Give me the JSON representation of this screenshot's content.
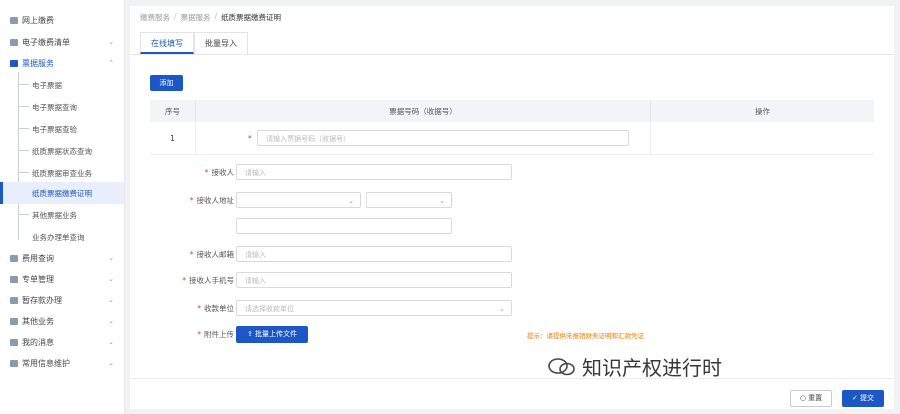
{
  "sidebar": {
    "items": [
      {
        "label": "网上缴费",
        "icon": "home-icon"
      },
      {
        "label": "电子缴费清单",
        "icon": "list-icon"
      },
      {
        "label": "票据服务",
        "icon": "bank-icon"
      },
      {
        "label": "费用查询",
        "icon": "search-icon"
      },
      {
        "label": "专单管理",
        "icon": "document-icon"
      },
      {
        "label": "暂存款办理",
        "icon": "wallet-icon"
      },
      {
        "label": "其他业务",
        "icon": "briefcase-icon"
      },
      {
        "label": "我的消息",
        "icon": "bell-icon"
      },
      {
        "label": "常用信息维护",
        "icon": "edit-icon"
      }
    ],
    "subitems": [
      "电子票据",
      "电子票据查询",
      "电子票据查验",
      "纸质票据状态查询",
      "纸质票据审查业务",
      "纸质票据缴费证明",
      "其他票据业务",
      "业务办理单查询"
    ]
  },
  "breadcrumb": [
    "缴费服务",
    "票据服务",
    "纸质票据缴费证明"
  ],
  "tabs": [
    "在线填写",
    "批量导入"
  ],
  "add_button": "添加",
  "table": {
    "headers": [
      "序号",
      "票据号码（收据号）",
      "操作"
    ],
    "rows": [
      {
        "index": "1",
        "placeholder": "请输入票据号码（收据号）"
      }
    ]
  },
  "form": {
    "receiver": {
      "label": "接收人",
      "placeholder": "请输入"
    },
    "receiver_address": {
      "label": "接收人地址"
    },
    "receiver_email": {
      "label": "接收人邮箱",
      "placeholder": "请输入"
    },
    "receiver_phone": {
      "label": "接收人手机号",
      "placeholder": "请输入"
    },
    "payee_unit": {
      "label": "收款单位",
      "placeholder": "请选择收款单位"
    },
    "attachment": {
      "label": "附件上传",
      "button": "批量上传文件",
      "tip": "提示：请提供未报销财务证明和汇款凭证"
    }
  },
  "footer": {
    "reset": "重置",
    "submit": "提交"
  },
  "watermark": "知识产权进行时",
  "colors": {
    "primary": "#1c57c6",
    "warning": "#f07c00"
  }
}
